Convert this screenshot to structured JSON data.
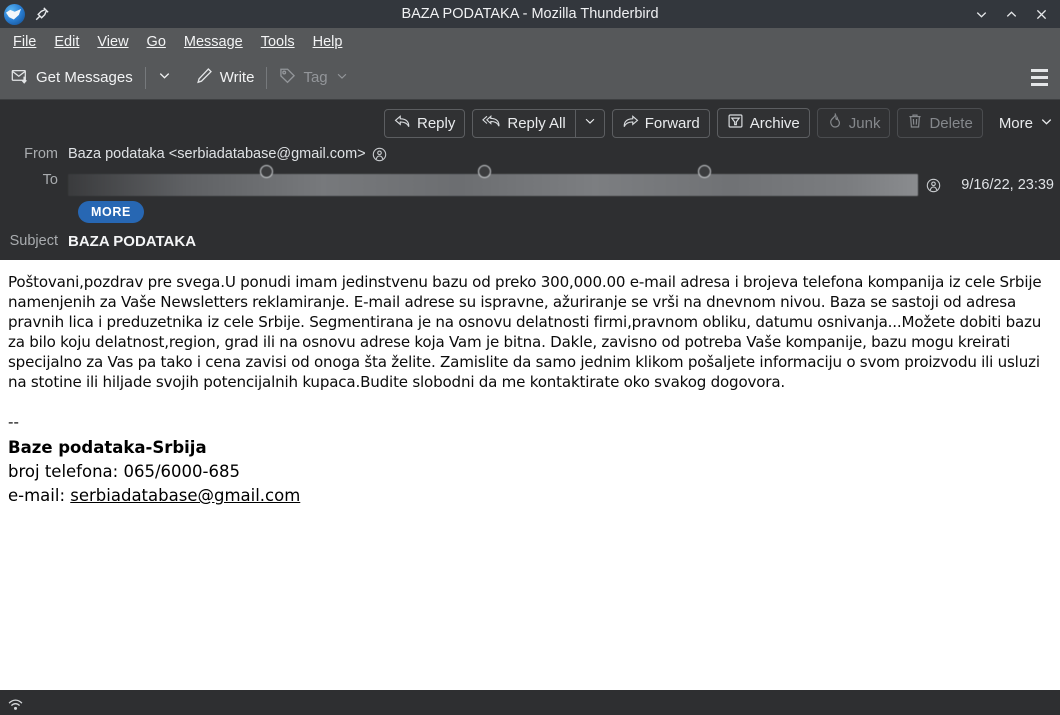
{
  "window": {
    "title": "BAZA PODATAKA - Mozilla Thunderbird",
    "logo_icon": "thunderbird-logo-icon",
    "pin_icon": "pin-icon",
    "minimize_icon": "chevron-down-icon",
    "maximize_icon": "chevron-up-icon",
    "close_icon": "close-icon",
    "titlebar_color": "#33373d"
  },
  "menubar": {
    "items": [
      {
        "label": "File",
        "accel": "F"
      },
      {
        "label": "Edit",
        "accel": "E"
      },
      {
        "label": "View",
        "accel": "V"
      },
      {
        "label": "Go",
        "accel": "G"
      },
      {
        "label": "Message",
        "accel": "M"
      },
      {
        "label": "Tools",
        "accel": "T"
      },
      {
        "label": "Help",
        "accel": "H"
      }
    ]
  },
  "toolbar": {
    "get_messages_label": "Get Messages",
    "get_messages_icon": "get-messages-icon",
    "get_messages_dropdown_icon": "chevron-down-icon",
    "write_label": "Write",
    "write_icon": "pencil-icon",
    "tag_label": "Tag",
    "tag_icon": "tag-icon",
    "tag_dropdown_icon": "chevron-down-icon",
    "tag_disabled": true,
    "hamburger_icon": "hamburger-menu-icon",
    "background_color": "#56585a"
  },
  "message_actions": {
    "reply_label": "Reply",
    "reply_icon": "reply-arrow-icon",
    "reply_all_label": "Reply All",
    "reply_all_icon": "reply-all-arrow-icon",
    "reply_all_dropdown_icon": "chevron-down-icon",
    "forward_label": "Forward",
    "forward_icon": "forward-arrow-icon",
    "archive_label": "Archive",
    "archive_icon": "archive-box-icon",
    "junk_label": "Junk",
    "junk_icon": "flame-icon",
    "junk_disabled": true,
    "delete_label": "Delete",
    "delete_icon": "trash-icon",
    "delete_disabled": true,
    "more_label": "More",
    "more_dropdown_icon": "chevron-down-icon"
  },
  "headers": {
    "from_label": "From",
    "from_value": "Baza podataka <serbiadatabase@gmail.com>",
    "from_contact_icon": "add-contact-icon",
    "to_label": "To",
    "to_value": "",
    "to_redacted": true,
    "to_contact_icon": "add-contact-icon",
    "date": "9/16/22, 23:39",
    "more_button_label": "MORE",
    "more_button_color": "#2767b3",
    "subject_label": "Subject",
    "subject_value": "BAZA PODATAKA"
  },
  "body": {
    "paragraph": "Poštovani,pozdrav pre svega.U ponudi imam jedinstvenu bazu od preko 300,000.00  e-mail adresa i brojeva telefona kompanija iz cele Srbije namenjenih za Vaše Newsletters reklamiranje. E-mail adrese su ispravne, ažuriranje se vrši na dnevnom nivou. Baza se sastoji od adresa pravnih lica i preduzetnika iz cele Srbije. Segmentirana je na osnovu delatnosti firmi,pravnom obliku, datumu osnivanja...Možete dobiti bazu za bilo koju delatnost,region, grad ili na osnovu adrese koja Vam je bitna. Dakle, zavisno od potreba Vaše kompanije, bazu mogu kreirati specijalno za Vas pa tako i cena zavisi od onoga šta želite. Zamislite da samo jednim klikom pošaljete informaciju o svom proizvodu ili usluzi na stotine ili hiljade svojih potencijalnih kupaca.Budite slobodni da me kontaktirate oko svakog dogovora.",
    "signature_separator": "--",
    "signature_name": "Baze podataka-Srbija",
    "signature_phone": "broj telefona: 065/6000-685",
    "signature_email_label": "e-mail: ",
    "signature_email": "serbiadatabase@gmail.com"
  },
  "statusbar": {
    "wifi_icon": "wifi-broadcast-icon"
  }
}
